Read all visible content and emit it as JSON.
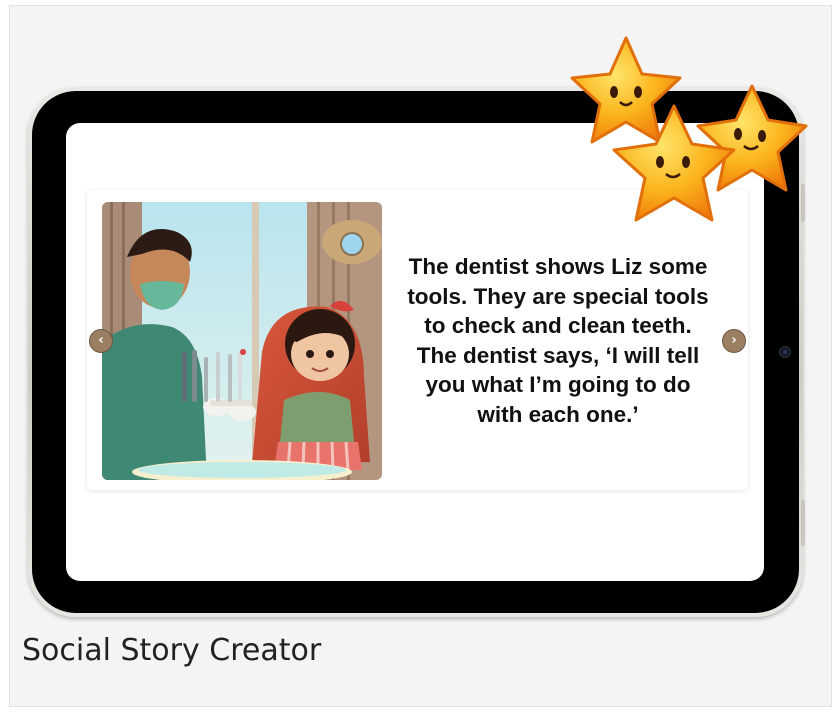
{
  "story": {
    "text": "The dentist shows Liz some tools. They are special tools to check and clean teeth. The dentist says, ‘I will tell you what I’m going to do with each one.’"
  },
  "navigation": {
    "prev_icon": "chevron-left-icon",
    "prev_glyph": "‹",
    "next_icon": "chevron-right-icon",
    "next_glyph": "›"
  },
  "caption": {
    "title": "Social Story Creator"
  },
  "colors": {
    "nav_button": "#9a7f62",
    "star_gold": "#fbb51d",
    "star_orange": "#f07a0c"
  }
}
